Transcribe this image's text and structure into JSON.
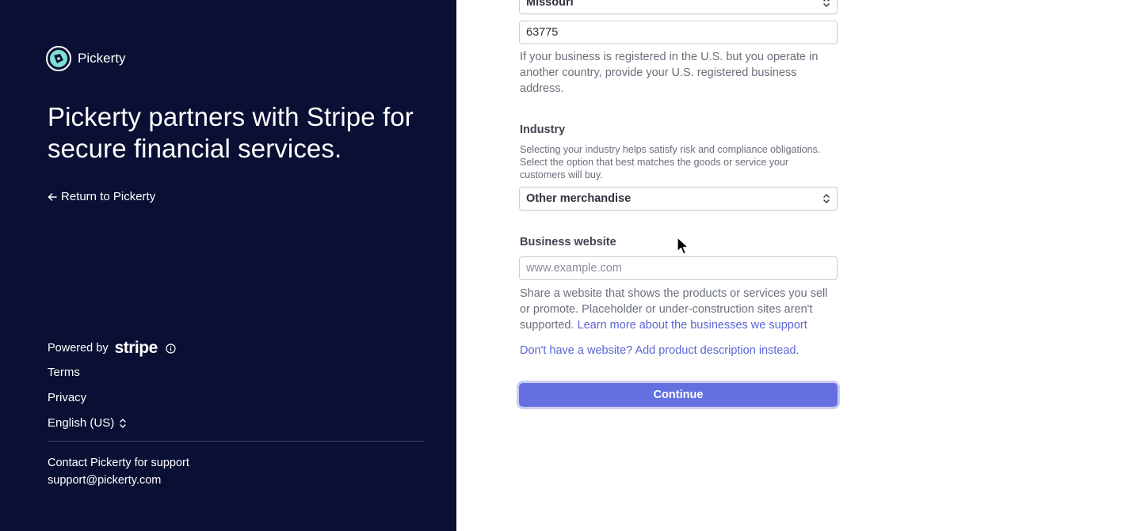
{
  "sidebar": {
    "brand_name": "Pickerty",
    "headline": "Pickerty partners with Stripe for secure financial services.",
    "return_link": "Return to Pickerty",
    "powered_by": "Powered by",
    "stripe_word": "stripe",
    "links": {
      "terms": "Terms",
      "privacy": "Privacy"
    },
    "language": "English (US)",
    "support_text": "Contact Pickerty for support",
    "support_email": "support@pickerty.com"
  },
  "form": {
    "state_value": "Missouri",
    "zip_value": "63775",
    "address_help": "If your business is registered in the U.S. but you operate in another country, provide your U.S. registered business address.",
    "industry": {
      "label": "Industry",
      "help": "Selecting your industry helps satisfy risk and compliance obligations. Select the option that best matches the goods or service your customers will buy.",
      "value": "Other merchandise"
    },
    "website": {
      "label": "Business website",
      "placeholder": "www.example.com",
      "help": "Share a website that shows the products or services you sell or promote. Placeholder or under-construction sites aren't supported.",
      "learn_more": "Learn more about the businesses we support",
      "no_website_link": "Don't have a website? Add product description instead."
    },
    "continue_label": "Continue"
  }
}
